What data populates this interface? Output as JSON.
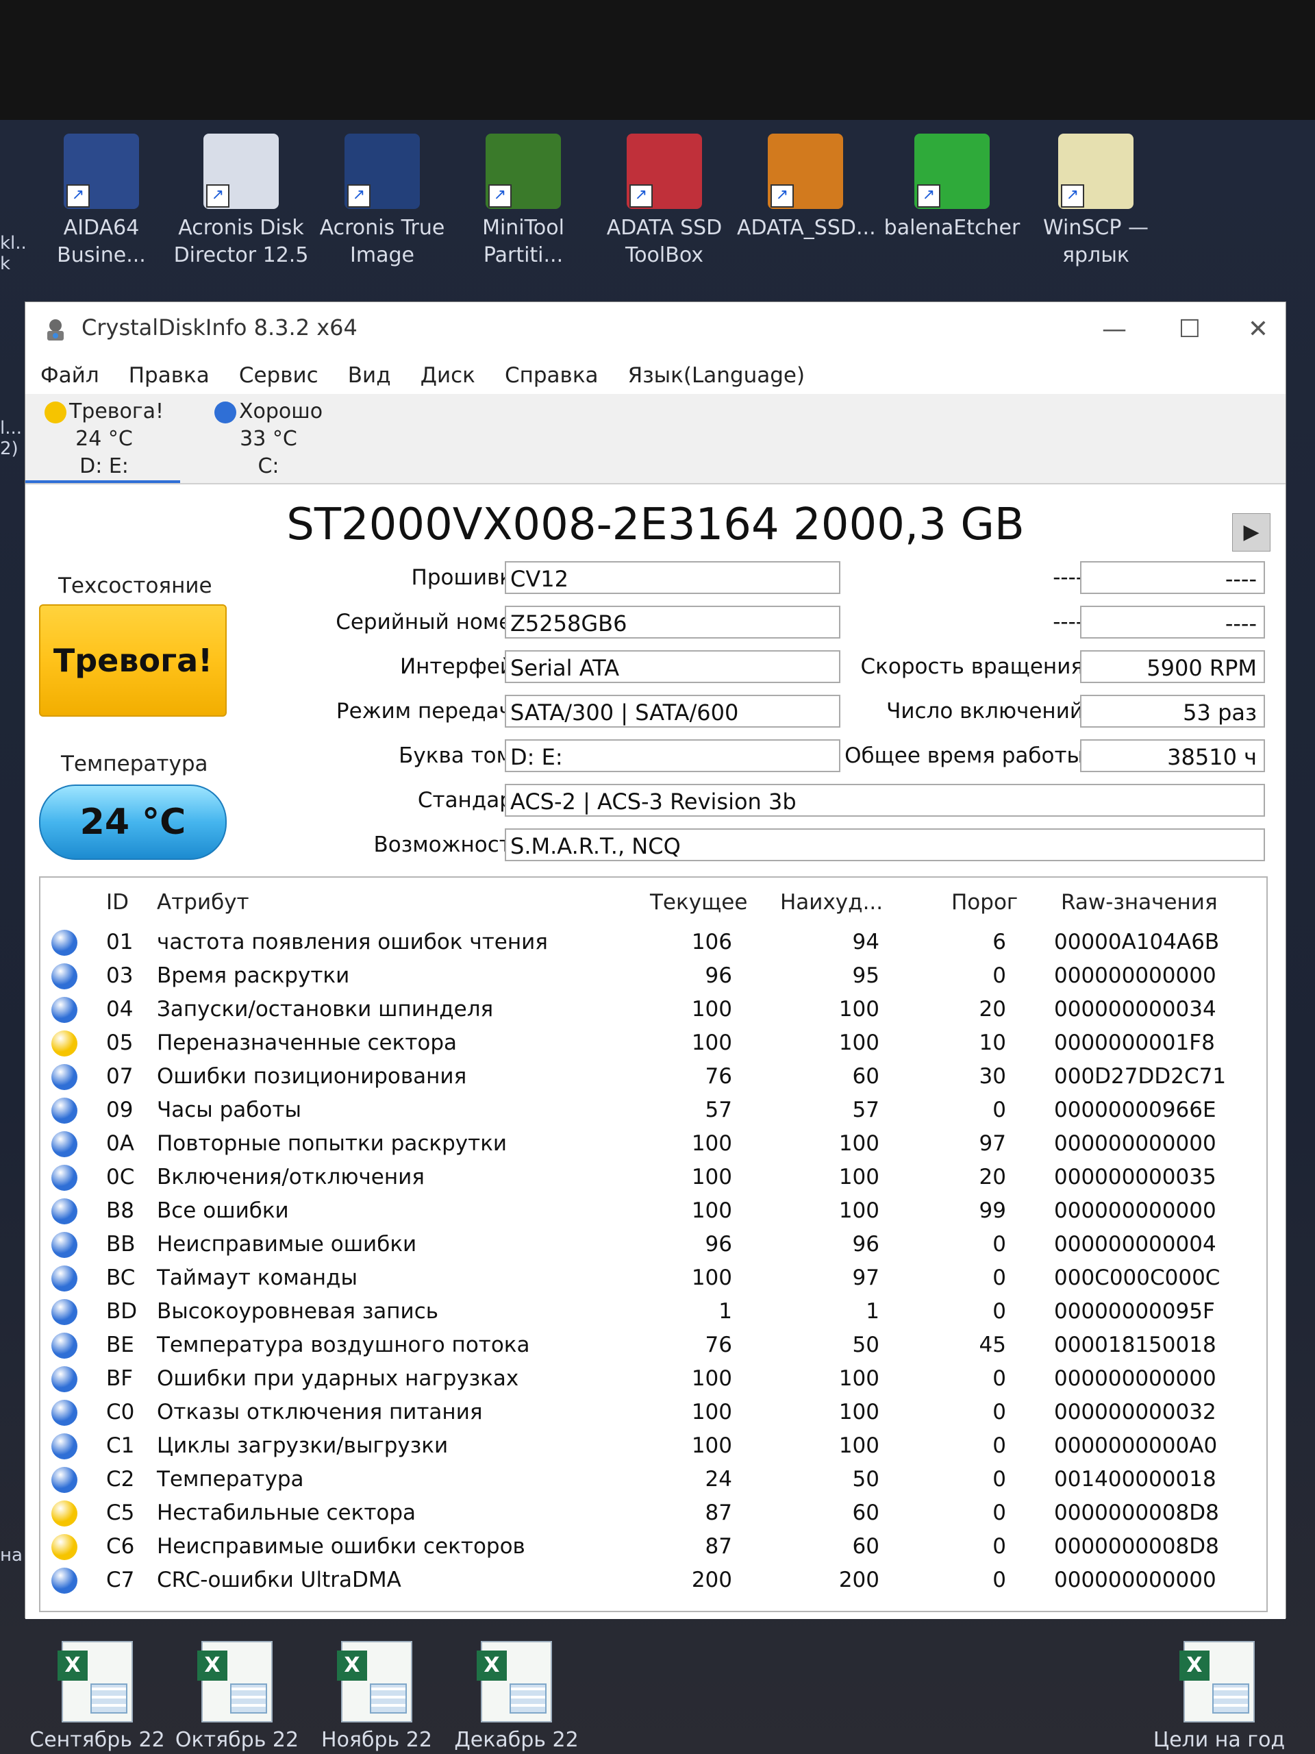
{
  "desktop": {
    "top_icons": [
      {
        "label1": "AIDA64",
        "label2": "Busine...",
        "color": "#2c4a8c"
      },
      {
        "label1": "Acronis Disk",
        "label2": "Director 12.5",
        "color": "#d8dde8"
      },
      {
        "label1": "Acronis True",
        "label2": "Image",
        "color": "#23407a"
      },
      {
        "label1": "MiniTool",
        "label2": "Partiti...",
        "color": "#3a7a2a"
      },
      {
        "label1": "ADATA SSD",
        "label2": "ToolBox",
        "color": "#c0303a"
      },
      {
        "label1": "ADATA_SSD...",
        "label2": "",
        "color": "#d27a1e"
      },
      {
        "label1": "balenaEtcher",
        "label2": "",
        "color": "#2faa3a"
      },
      {
        "label1": "WinSCP —",
        "label2": "ярлык",
        "color": "#e6e0b0"
      }
    ],
    "bottom_icons": [
      {
        "label": "Сентябрь 22"
      },
      {
        "label": "Октябрь 22"
      },
      {
        "label": "Ноябрь 22"
      },
      {
        "label": "Декабрь 22"
      },
      {
        "label": "Цели на год"
      }
    ],
    "left_strip_top": "kl...\nk",
    "left_strip_mid": "l...\n2)",
    "left_strip_bottom": "на",
    "bottom_left_edge": "на"
  },
  "window": {
    "title": "CrystalDiskInfo 8.3.2 x64",
    "minimize": "—",
    "maximize": "☐",
    "close": "✕",
    "menu": [
      "Файл",
      "Правка",
      "Сервис",
      "Вид",
      "Диск",
      "Справка",
      "Язык(Language)"
    ],
    "disk_tabs": [
      {
        "status": "Тревога!",
        "temp": "24 °C",
        "letters": "D: E:",
        "color": "#f6c400"
      },
      {
        "status": "Хорошо",
        "temp": "33 °C",
        "letters": "C:",
        "color": "#2f6fd6"
      }
    ]
  },
  "disk": {
    "model": "ST2000VX008-2E3164 2000,3 GB",
    "next_button": "▶",
    "health_label": "Техсостояние",
    "health_value": "Тревога!",
    "temp_label": "Температура",
    "temp_value": "24 °C",
    "fields": {
      "firmware_label": "Прошивка",
      "firmware": "CV12",
      "serial_label": "Серийный номер",
      "serial": "Z5258GB6",
      "interface_label": "Интерфейс",
      "interface": "Serial ATA",
      "transfer_label": "Режим передачи",
      "transfer": "SATA/300 | SATA/600",
      "drive_label": "Буква тома",
      "drive": "D: E:",
      "standard_label": "Стандарт",
      "standard": "ACS-2 | ACS-3 Revision 3b",
      "features_label": "Возможности",
      "features": "S.M.A.R.T., NCQ",
      "blank1_label": "----",
      "blank1": "----",
      "blank2_label": "----",
      "blank2": "----",
      "rotation_label": "Скорость вращения",
      "rotation": "5900 RPM",
      "power_count_label": "Число включений",
      "power_count": "53 раз",
      "power_hours_label": "Общее время работы",
      "power_hours": "38510 ч"
    }
  },
  "smart": {
    "headers": {
      "id": "ID",
      "attr": "Атрибут",
      "cur": "Текущее",
      "worst": "Наихуд...",
      "thr": "Порог",
      "raw": "Raw-значения"
    },
    "rows": [
      {
        "status": "good",
        "id": "01",
        "name": "частота появления ошибок чтения",
        "cur": "106",
        "worst": "94",
        "thr": "6",
        "raw": "00000A104A6B"
      },
      {
        "status": "good",
        "id": "03",
        "name": "Время раскрутки",
        "cur": "96",
        "worst": "95",
        "thr": "0",
        "raw": "000000000000"
      },
      {
        "status": "good",
        "id": "04",
        "name": "Запуски/остановки шпинделя",
        "cur": "100",
        "worst": "100",
        "thr": "20",
        "raw": "000000000034"
      },
      {
        "status": "warn",
        "id": "05",
        "name": "Переназначенные сектора",
        "cur": "100",
        "worst": "100",
        "thr": "10",
        "raw": "0000000001F8"
      },
      {
        "status": "good",
        "id": "07",
        "name": "Ошибки позиционирования",
        "cur": "76",
        "worst": "60",
        "thr": "30",
        "raw": "000D27DD2C71"
      },
      {
        "status": "good",
        "id": "09",
        "name": "Часы работы",
        "cur": "57",
        "worst": "57",
        "thr": "0",
        "raw": "00000000966E"
      },
      {
        "status": "good",
        "id": "0A",
        "name": "Повторные попытки раскрутки",
        "cur": "100",
        "worst": "100",
        "thr": "97",
        "raw": "000000000000"
      },
      {
        "status": "good",
        "id": "0C",
        "name": "Включения/отключения",
        "cur": "100",
        "worst": "100",
        "thr": "20",
        "raw": "000000000035"
      },
      {
        "status": "good",
        "id": "B8",
        "name": "Все ошибки",
        "cur": "100",
        "worst": "100",
        "thr": "99",
        "raw": "000000000000"
      },
      {
        "status": "good",
        "id": "BB",
        "name": "Неисправимые ошибки",
        "cur": "96",
        "worst": "96",
        "thr": "0",
        "raw": "000000000004"
      },
      {
        "status": "good",
        "id": "BC",
        "name": "Таймаут команды",
        "cur": "100",
        "worst": "97",
        "thr": "0",
        "raw": "000C000C000C"
      },
      {
        "status": "good",
        "id": "BD",
        "name": "Высокоуровневая запись",
        "cur": "1",
        "worst": "1",
        "thr": "0",
        "raw": "00000000095F"
      },
      {
        "status": "good",
        "id": "BE",
        "name": "Температура воздушного потока",
        "cur": "76",
        "worst": "50",
        "thr": "45",
        "raw": "000018150018"
      },
      {
        "status": "good",
        "id": "BF",
        "name": "Ошибки при ударных нагрузках",
        "cur": "100",
        "worst": "100",
        "thr": "0",
        "raw": "000000000000"
      },
      {
        "status": "good",
        "id": "C0",
        "name": "Отказы отключения питания",
        "cur": "100",
        "worst": "100",
        "thr": "0",
        "raw": "000000000032"
      },
      {
        "status": "good",
        "id": "C1",
        "name": "Циклы загрузки/выгрузки",
        "cur": "100",
        "worst": "100",
        "thr": "0",
        "raw": "0000000000A0"
      },
      {
        "status": "good",
        "id": "C2",
        "name": "Температура",
        "cur": "24",
        "worst": "50",
        "thr": "0",
        "raw": "001400000018"
      },
      {
        "status": "warn",
        "id": "C5",
        "name": "Нестабильные сектора",
        "cur": "87",
        "worst": "60",
        "thr": "0",
        "raw": "0000000008D8"
      },
      {
        "status": "warn",
        "id": "C6",
        "name": "Неисправимые ошибки секторов",
        "cur": "87",
        "worst": "60",
        "thr": "0",
        "raw": "0000000008D8"
      },
      {
        "status": "good",
        "id": "C7",
        "name": "CRC-ошибки UltraDMA",
        "cur": "200",
        "worst": "200",
        "thr": "0",
        "raw": "000000000000"
      }
    ]
  },
  "colors": {
    "good": "#2f6fd6",
    "warn": "#f6c400"
  }
}
